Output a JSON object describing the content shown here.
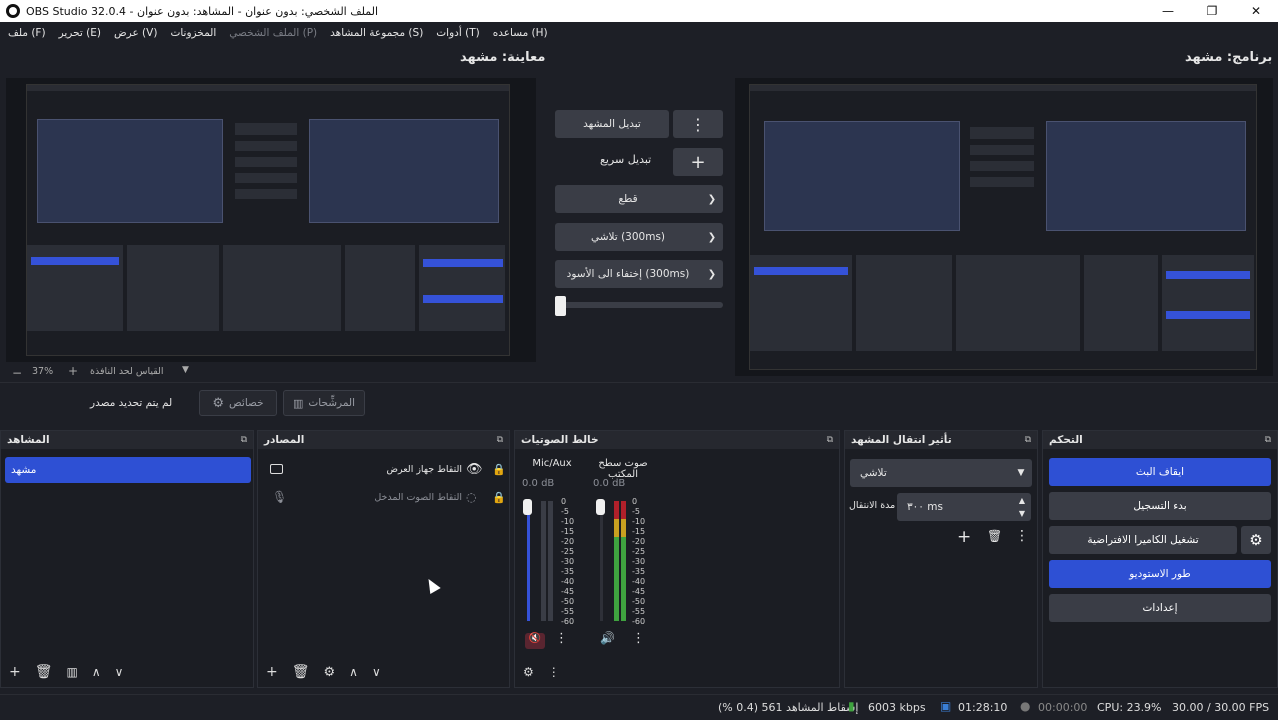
{
  "window": {
    "title": "OBS Studio 32.0.4 - الملف الشخصي: بدون عنوان - المشاهد: بدون عنوان",
    "minimize": "—",
    "restore": "❐",
    "close": "✕"
  },
  "menu": {
    "file": "ملف (F)",
    "edit": "تحرير (E)",
    "view": "عرض (V)",
    "docks": "المخزونات",
    "profile": "الملف الشخصي (P)",
    "scene_collection": "مجموعة المشاهد (S)",
    "tools": "أدوات (T)",
    "help": "مساعده (H)"
  },
  "preview": {
    "label": "معاينة: مشهد"
  },
  "program": {
    "label": "برنامج: مشهد"
  },
  "transition_panel": {
    "swap_scene": "تبديل المشهد",
    "quick_transition": "تبديل سريع",
    "cut": "قطع",
    "fade": "تلاشي (300ms)",
    "fade_to_black": "إختفاء الى الأسود (300ms)",
    "tbar_position": 0.0
  },
  "zoom": {
    "level": "37%",
    "fit_label": "القياس لحد النافذة"
  },
  "context": {
    "no_source": "لم يتم تحديد مصدر",
    "properties": "خصائص",
    "filters": "المرشِّحات"
  },
  "docks": {
    "scenes": {
      "title": "المشاهد",
      "items": [
        "مشهد"
      ]
    },
    "sources": {
      "title": "المصادر",
      "items": [
        {
          "label": "التقاط جهاز العرض",
          "visible": true,
          "icon": "monitor-icon"
        },
        {
          "label": "التقاط الصوت المدخل",
          "visible": false,
          "icon": "mic-icon"
        }
      ]
    },
    "mixer": {
      "title": "خالط الصوتيات",
      "channels": [
        {
          "name": "Mic/Aux",
          "db": "0.0 dB",
          "muted": true,
          "level": 0.0
        },
        {
          "name": "صوت سطح المكتب",
          "db": "0.0 dB",
          "muted": false,
          "level": 1.0
        }
      ],
      "scale": [
        "0",
        "-5",
        "-10",
        "-15",
        "-20",
        "-25",
        "-30",
        "-35",
        "-40",
        "-45",
        "-50",
        "-55",
        "-60"
      ]
    },
    "transitions": {
      "title": "تأثير انتقال المشهد",
      "selected": "تلاشي",
      "duration_label": "مدة الانتقال",
      "duration_value": "٣٠٠ ms"
    },
    "controls": {
      "title": "التحكم",
      "stop_stream": "ايقاف البث",
      "start_recording": "بدء التسجيل",
      "start_virtual_cam": "تشغيل الكاميرا الافتراضية",
      "studio_mode": "طور الاستوديو",
      "settings": "إعدادات"
    }
  },
  "status": {
    "dropped_frames": "إسقاط المشاهد 561 (0.4 %)",
    "bitrate": "6003 kbps",
    "stream_time": "01:28:10",
    "rec_time": "00:00:00",
    "cpu": "CPU: 23.9%",
    "fps": "30.00 / 30.00 FPS"
  },
  "colors": {
    "accent": "#2e50d4",
    "panel": "#1b1d23",
    "button": "#3a3d46",
    "meter_green": "#3fa33f",
    "meter_red": "#b0202a"
  }
}
